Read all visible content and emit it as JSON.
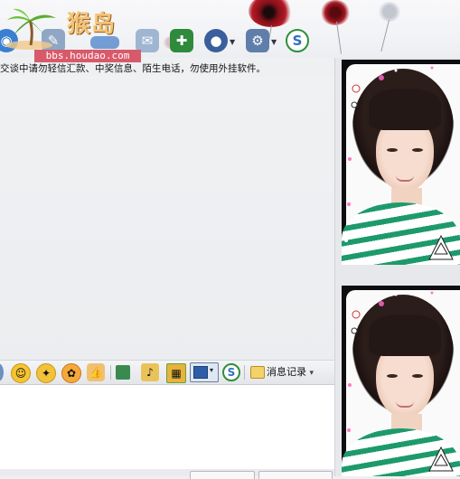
{
  "logo": {
    "text": "猴岛",
    "url": "bbs.houdao.com"
  },
  "toolbar": {
    "icons": [
      "qq-icon",
      "microphone-icon",
      "video-icon",
      "mail-icon",
      "add-message-icon",
      "profile-icon",
      "settings-icon",
      "soso-icon"
    ]
  },
  "notice": {
    "text": "交谈中请勿轻信汇款、中奖信息、陌生电话，勿使用外挂软件。"
  },
  "bottom_toolbar": {
    "history_label": "消息记录",
    "history_arrow": "▾",
    "screen_arrow": "▾"
  },
  "colors": {
    "accent_red": "#b51a24",
    "logo_pink": "#d85a6a",
    "shirt_green": "#1d9a6b"
  }
}
